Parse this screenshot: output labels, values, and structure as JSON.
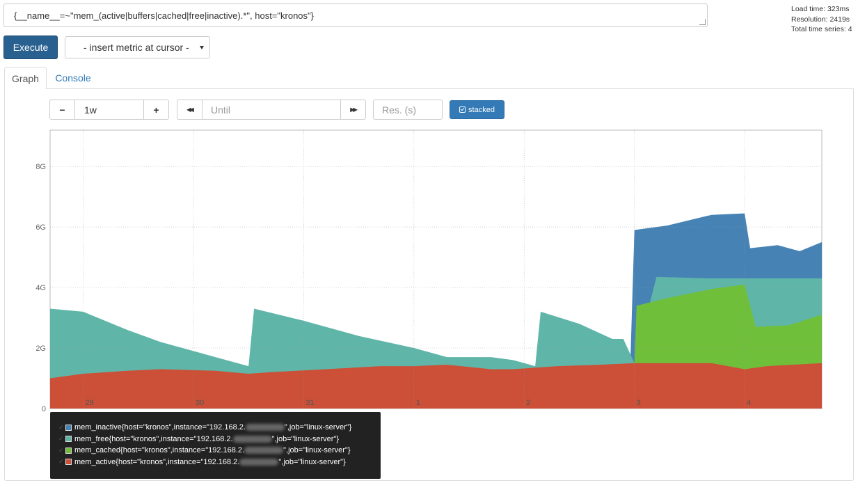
{
  "query": "{__name__=~\"mem_(active|buffers|cached|free|inactive).*\", host=\"kronos\"}",
  "stats": {
    "load_time": "Load time: 323ms",
    "resolution": "Resolution: 2419s",
    "total_series": "Total time series: 4"
  },
  "toolbar": {
    "execute_label": "Execute",
    "metric_select": "- insert metric at cursor -"
  },
  "tabs": {
    "graph": "Graph",
    "console": "Console"
  },
  "controls": {
    "minus": "−",
    "range": "1w",
    "plus": "+",
    "back": "◀◀",
    "until_placeholder": "Until",
    "forward": "▶▶",
    "res_placeholder": "Res. (s)",
    "stacked_label": "stacked"
  },
  "colors": {
    "inactive": "#4682b4",
    "free": "#5fb6a8",
    "cached": "#6fbf3b",
    "active": "#cc5038",
    "grid": "#cccccc"
  },
  "chart_data": {
    "type": "area",
    "stacked": true,
    "y_ticks": [
      "0",
      "2G",
      "4G",
      "6G",
      "8G"
    ],
    "ylim": [
      0,
      9.2
    ],
    "x_ticks": [
      "29",
      "30",
      "31",
      "1",
      "2",
      "3",
      "4"
    ],
    "xlim": [
      0,
      7
    ],
    "grid": true,
    "series": [
      {
        "name": "mem_active{host=\"kronos\",instance=\"192.168.2.\",job=\"linux-server\"}",
        "key": "active",
        "points": [
          [
            0,
            1.0
          ],
          [
            0.3,
            1.15
          ],
          [
            0.7,
            1.25
          ],
          [
            1.0,
            1.3
          ],
          [
            1.5,
            1.25
          ],
          [
            1.8,
            1.15
          ],
          [
            2.0,
            1.2
          ],
          [
            2.5,
            1.3
          ],
          [
            3.0,
            1.4
          ],
          [
            3.3,
            1.4
          ],
          [
            3.6,
            1.45
          ],
          [
            4.0,
            1.3
          ],
          [
            4.2,
            1.3
          ],
          [
            4.6,
            1.4
          ],
          [
            5.0,
            1.45
          ],
          [
            5.3,
            1.5
          ],
          [
            5.5,
            1.5
          ],
          [
            6.0,
            1.5
          ],
          [
            6.3,
            1.3
          ],
          [
            6.5,
            1.4
          ],
          [
            7.0,
            1.5
          ]
        ]
      },
      {
        "name": "mem_free{host=\"kronos\",instance=\"192.168.2.\",job=\"linux-server\"}",
        "key": "free",
        "points": [
          [
            0,
            3.3
          ],
          [
            0.3,
            3.2
          ],
          [
            0.7,
            2.6
          ],
          [
            1.0,
            2.2
          ],
          [
            1.5,
            1.7
          ],
          [
            1.8,
            1.4
          ],
          [
            1.85,
            3.3
          ],
          [
            2.3,
            2.9
          ],
          [
            2.8,
            2.4
          ],
          [
            3.3,
            2.0
          ],
          [
            3.6,
            1.7
          ],
          [
            4.0,
            1.7
          ],
          [
            4.2,
            1.6
          ],
          [
            4.4,
            1.4
          ],
          [
            4.45,
            3.2
          ],
          [
            4.8,
            2.8
          ],
          [
            5.1,
            2.3
          ],
          [
            5.2,
            2.3
          ],
          [
            5.3,
            1.5
          ],
          [
            5.5,
            4.35
          ],
          [
            6.0,
            4.3
          ],
          [
            6.3,
            4.3
          ],
          [
            6.5,
            4.3
          ],
          [
            7.0,
            4.3
          ]
        ]
      },
      {
        "name": "mem_cached{host=\"kronos\",instance=\"192.168.2.\",job=\"linux-server\"}",
        "key": "cached",
        "points": [
          [
            0,
            0
          ],
          [
            5.25,
            0
          ],
          [
            5.3,
            1.5
          ],
          [
            5.32,
            3.4
          ],
          [
            5.6,
            3.65
          ],
          [
            6.0,
            3.95
          ],
          [
            6.3,
            4.1
          ],
          [
            6.4,
            2.7
          ],
          [
            6.7,
            2.75
          ],
          [
            7.0,
            3.1
          ]
        ]
      },
      {
        "name": "mem_inactive{host=\"kronos\",instance=\"192.168.2.\",job=\"linux-server\"}",
        "key": "inactive",
        "points": [
          [
            0,
            0
          ],
          [
            5.25,
            0
          ],
          [
            5.3,
            5.9
          ],
          [
            5.6,
            6.05
          ],
          [
            6.0,
            6.4
          ],
          [
            6.3,
            6.45
          ],
          [
            6.35,
            5.3
          ],
          [
            6.6,
            5.4
          ],
          [
            6.8,
            5.2
          ],
          [
            7.0,
            5.5
          ]
        ]
      }
    ]
  },
  "legend": [
    {
      "prefix": "mem_inactive{host=\"kronos\",instance=\"192.168.2.",
      "suffix": "\",job=\"linux-server\"}",
      "color_key": "inactive"
    },
    {
      "prefix": "mem_free{host=\"kronos\",instance=\"192.168.2.",
      "suffix": "\",job=\"linux-server\"}",
      "color_key": "free"
    },
    {
      "prefix": "mem_cached{host=\"kronos\",instance=\"192.168.2.",
      "suffix": "\",job=\"linux-server\"}",
      "color_key": "cached"
    },
    {
      "prefix": "mem_active{host=\"kronos\",instance=\"192.168.2.",
      "suffix": "\",job=\"linux-server\"}",
      "color_key": "active"
    }
  ]
}
